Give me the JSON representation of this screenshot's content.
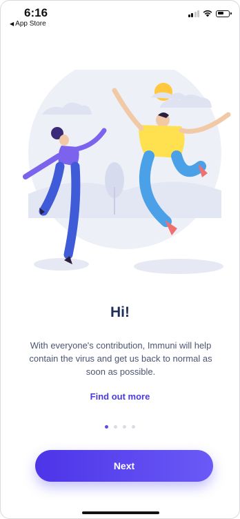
{
  "status_bar": {
    "time": "6:16",
    "back_label": "App Store"
  },
  "onboarding": {
    "title": "Hi!",
    "body": "With everyone's contribution, Immuni will help contain the virus and get us back to normal as soon as possible.",
    "link_label": "Find out more",
    "pager": {
      "total": 4,
      "active": 0
    },
    "next_label": "Next"
  },
  "colors": {
    "accent": "#5a4cf0",
    "title": "#1f2f5a",
    "body": "#4b5572"
  },
  "icons": {
    "signal": "signal-icon",
    "wifi": "wifi-icon",
    "battery": "battery-icon",
    "back": "back-triangle-icon"
  }
}
